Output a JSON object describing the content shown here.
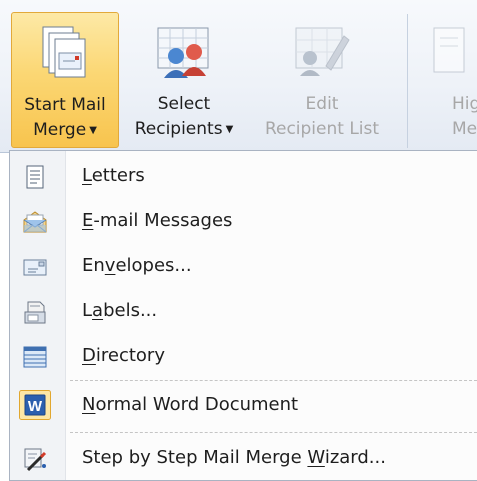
{
  "ribbon": {
    "start_mail_merge": {
      "line1": "Start Mail",
      "line2": "Merge"
    },
    "select_recipients": {
      "line1": "Select",
      "line2": "Recipients"
    },
    "edit_recipient_list": {
      "line1": "Edit",
      "line2": "Recipient List"
    },
    "highlight_merge_fields": {
      "line1": "Hig",
      "line2": "Merg"
    }
  },
  "menu": {
    "items": [
      {
        "pre": "",
        "key": "L",
        "post": "etters",
        "icon": "letter-icon"
      },
      {
        "pre": "",
        "key": "E",
        "post": "-mail Messages",
        "icon": "email-icon"
      },
      {
        "pre": "En",
        "key": "v",
        "post": "elopes...",
        "icon": "envelope-icon"
      },
      {
        "pre": "L",
        "key": "a",
        "post": "bels...",
        "icon": "labels-icon"
      },
      {
        "pre": "",
        "key": "D",
        "post": "irectory",
        "icon": "directory-icon"
      },
      {
        "pre": "",
        "key": "N",
        "post": "ormal Word Document",
        "icon": "word-icon"
      },
      {
        "pre": "Step by Step Mail Merge ",
        "key": "W",
        "post": "izard...",
        "icon": "wizard-icon"
      }
    ]
  },
  "colors": {
    "active_button": "#fbd774",
    "menu_border": "#a9b3c2",
    "disabled_text": "#a7a7a7"
  }
}
